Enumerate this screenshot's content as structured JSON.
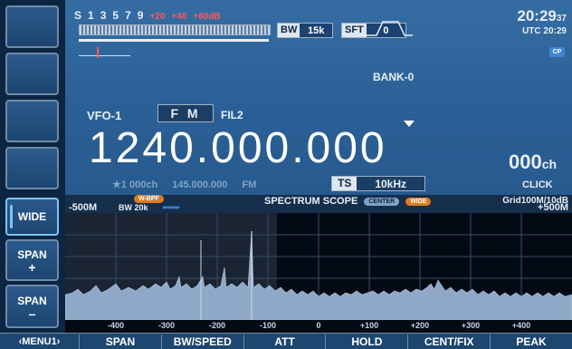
{
  "left_keys": [
    {
      "label": "",
      "sub": ""
    },
    {
      "label": "",
      "sub": ""
    },
    {
      "label": "",
      "sub": ""
    },
    {
      "label": "",
      "sub": ""
    },
    {
      "label": "WIDE",
      "sub": ""
    },
    {
      "label": "SPAN",
      "sub": "+"
    },
    {
      "label": "SPAN",
      "sub": "–"
    }
  ],
  "meter": {
    "scale": [
      "S",
      "1",
      "3",
      "5",
      "7",
      "9"
    ],
    "scale_red": [
      "+20",
      "+40",
      "+60dB"
    ]
  },
  "bw": {
    "label": "BW",
    "value": "15k"
  },
  "sft": {
    "label": "SFT",
    "value": "0"
  },
  "clock": {
    "time_main": "20:29",
    "time_sec": "37",
    "utc_label": "UTC",
    "utc_time": "20:29",
    "cp_badge": "CP"
  },
  "bank": "BANK-0",
  "vfo": "VFO-1",
  "mode": "F M",
  "filter": "FIL2",
  "frequency": "1240.000.000",
  "channel": {
    "number": "000",
    "unit": "ch"
  },
  "memory_line": {
    "step": "★1 000ch",
    "freq": "145.000.000",
    "mode": "FM"
  },
  "tuning_step": {
    "label": "TS",
    "value": "10kHz"
  },
  "click": "CLICK",
  "spectrum": {
    "wbpf_tag": "W-BPF",
    "title": "SPECTRUM SCOPE",
    "center_tag": "CENTER",
    "wide_tag": "WIDE",
    "grid": "Grid100M/10dB",
    "left_edge": "-500M",
    "right_edge": "+500M",
    "bw": "BW 20k",
    "arrows": "▸▸▸▸▸▸",
    "x_ticks": [
      "-400",
      "-300",
      "-200",
      "-100",
      "0",
      "+100",
      "+200",
      "+300",
      "+400"
    ]
  },
  "menu": [
    "‹MENU1›",
    "SPAN",
    "BW/SPEED",
    "ATT",
    "HOLD",
    "CENT/FIX",
    "PEAK"
  ],
  "colors": {
    "bg_top": "#2a5f95",
    "spectrum_fill": "#8fa8c8",
    "accent_red": "#ff5a5a"
  }
}
